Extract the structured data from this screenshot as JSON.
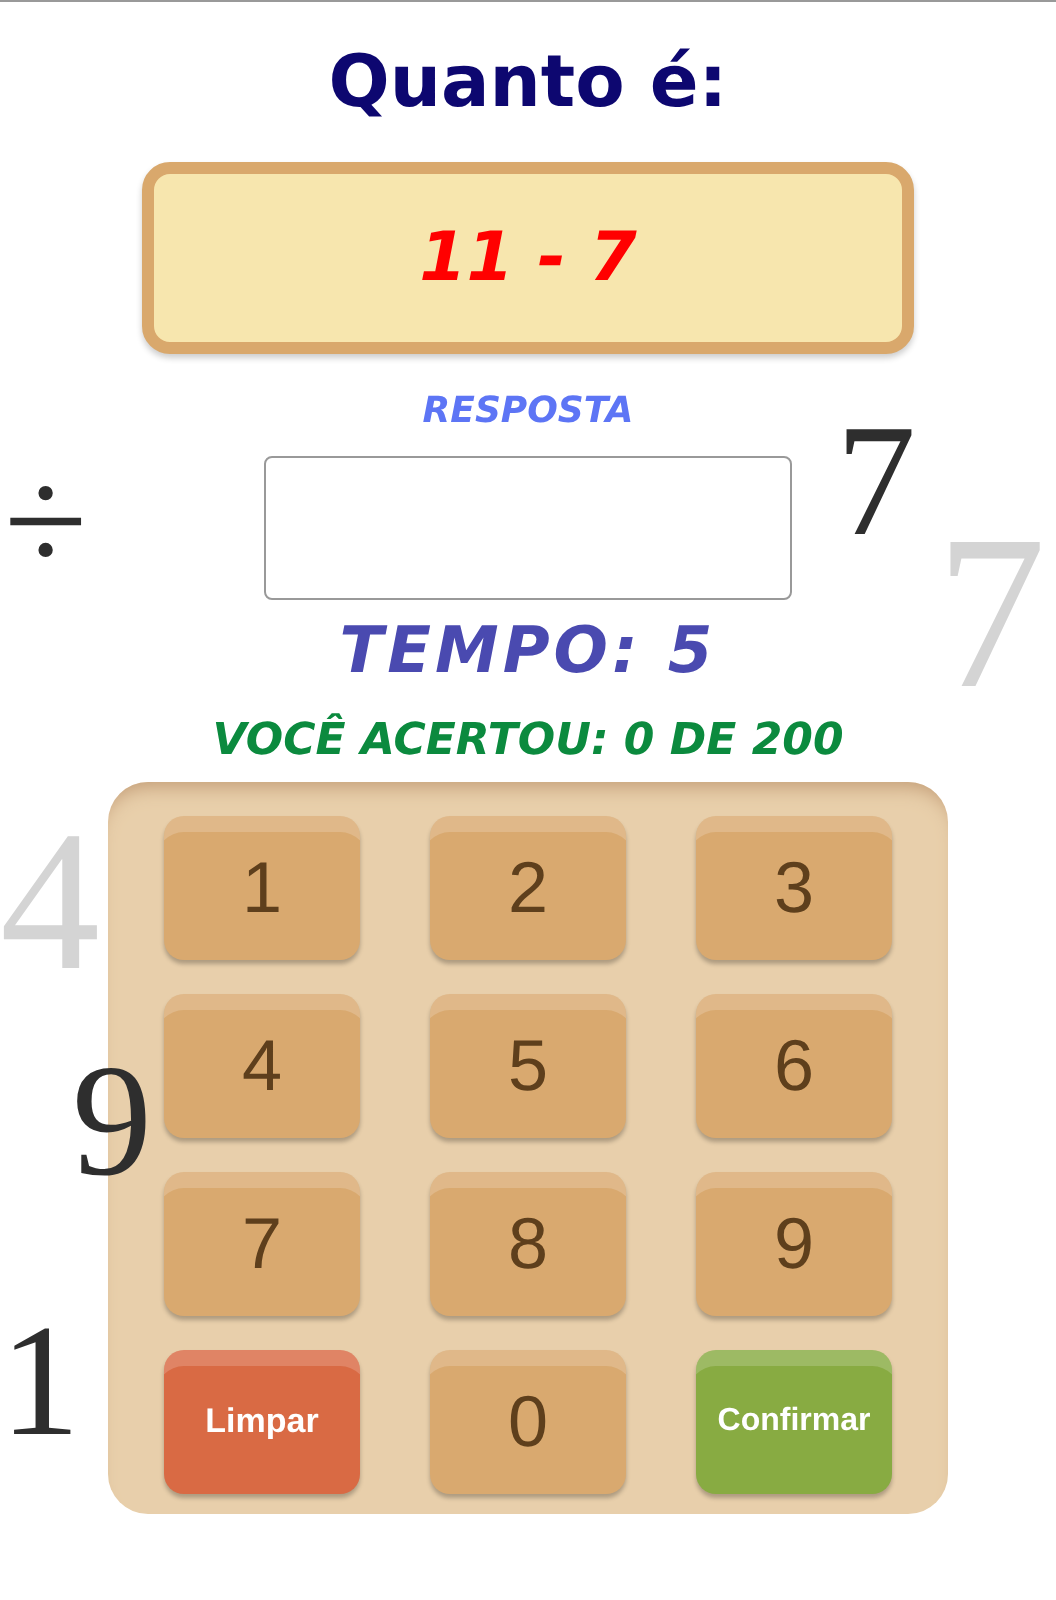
{
  "background_symbols": [
    {
      "text": "÷",
      "kind": "dark"
    },
    {
      "text": "7",
      "kind": "dark"
    },
    {
      "text": "7",
      "kind": "light"
    },
    {
      "text": "4",
      "kind": "light"
    },
    {
      "text": "9",
      "kind": "dark"
    },
    {
      "text": "1",
      "kind": "dark"
    }
  ],
  "title": "Quanto é:",
  "problem": "11 - 7",
  "answer_label": "RESPOSTA",
  "timer": "TEMPO: 5",
  "score": "VOCÊ ACERTOU: 0 DE 200",
  "keys": [
    {
      "label": "1",
      "kind": "digit"
    },
    {
      "label": "2",
      "kind": "digit"
    },
    {
      "label": "3",
      "kind": "digit"
    },
    {
      "label": "4",
      "kind": "digit"
    },
    {
      "label": "5",
      "kind": "digit"
    },
    {
      "label": "6",
      "kind": "digit"
    },
    {
      "label": "7",
      "kind": "digit"
    },
    {
      "label": "8",
      "kind": "digit"
    },
    {
      "label": "9",
      "kind": "digit"
    },
    {
      "label": "Limpar",
      "kind": "clear"
    },
    {
      "label": "0",
      "kind": "digit"
    },
    {
      "label": "Confirmar",
      "kind": "confirm"
    }
  ]
}
